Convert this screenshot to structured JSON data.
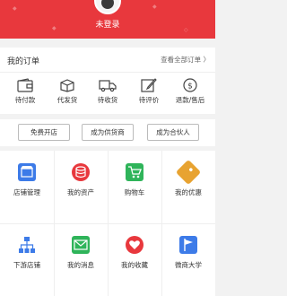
{
  "profile": {
    "name": "未登录"
  },
  "orders": {
    "title": "我的订单",
    "view_all": "查看全部订单 〉",
    "items": [
      {
        "label": "待付款",
        "icon": "wallet-icon"
      },
      {
        "label": "代发货",
        "icon": "box-icon"
      },
      {
        "label": "待收货",
        "icon": "truck-icon"
      },
      {
        "label": "待评价",
        "icon": "edit-icon"
      },
      {
        "label": "退款/售后",
        "icon": "refund-icon"
      }
    ]
  },
  "actions": [
    {
      "label": "免费开店"
    },
    {
      "label": "成为供货商"
    },
    {
      "label": "成为合伙人"
    }
  ],
  "grid": [
    {
      "label": "店铺管理",
      "icon": "store-icon",
      "color": "#3d7be8"
    },
    {
      "label": "我的资产",
      "icon": "coins-icon",
      "color": "#e8383d"
    },
    {
      "label": "购物车",
      "icon": "cart-icon",
      "color": "#2fb45a"
    },
    {
      "label": "我的优惠",
      "icon": "tag-icon",
      "color": "#e8a331"
    },
    {
      "label": "下游店铺",
      "icon": "hierarchy-icon",
      "color": "#3d7be8"
    },
    {
      "label": "我的消息",
      "icon": "mail-icon",
      "color": "#2fb45a"
    },
    {
      "label": "我的收藏",
      "icon": "heart-icon",
      "color": "#e8383d"
    },
    {
      "label": "微商大学",
      "icon": "flag-icon",
      "color": "#3d7be8"
    }
  ],
  "colors": {
    "header": "#e8383d"
  }
}
